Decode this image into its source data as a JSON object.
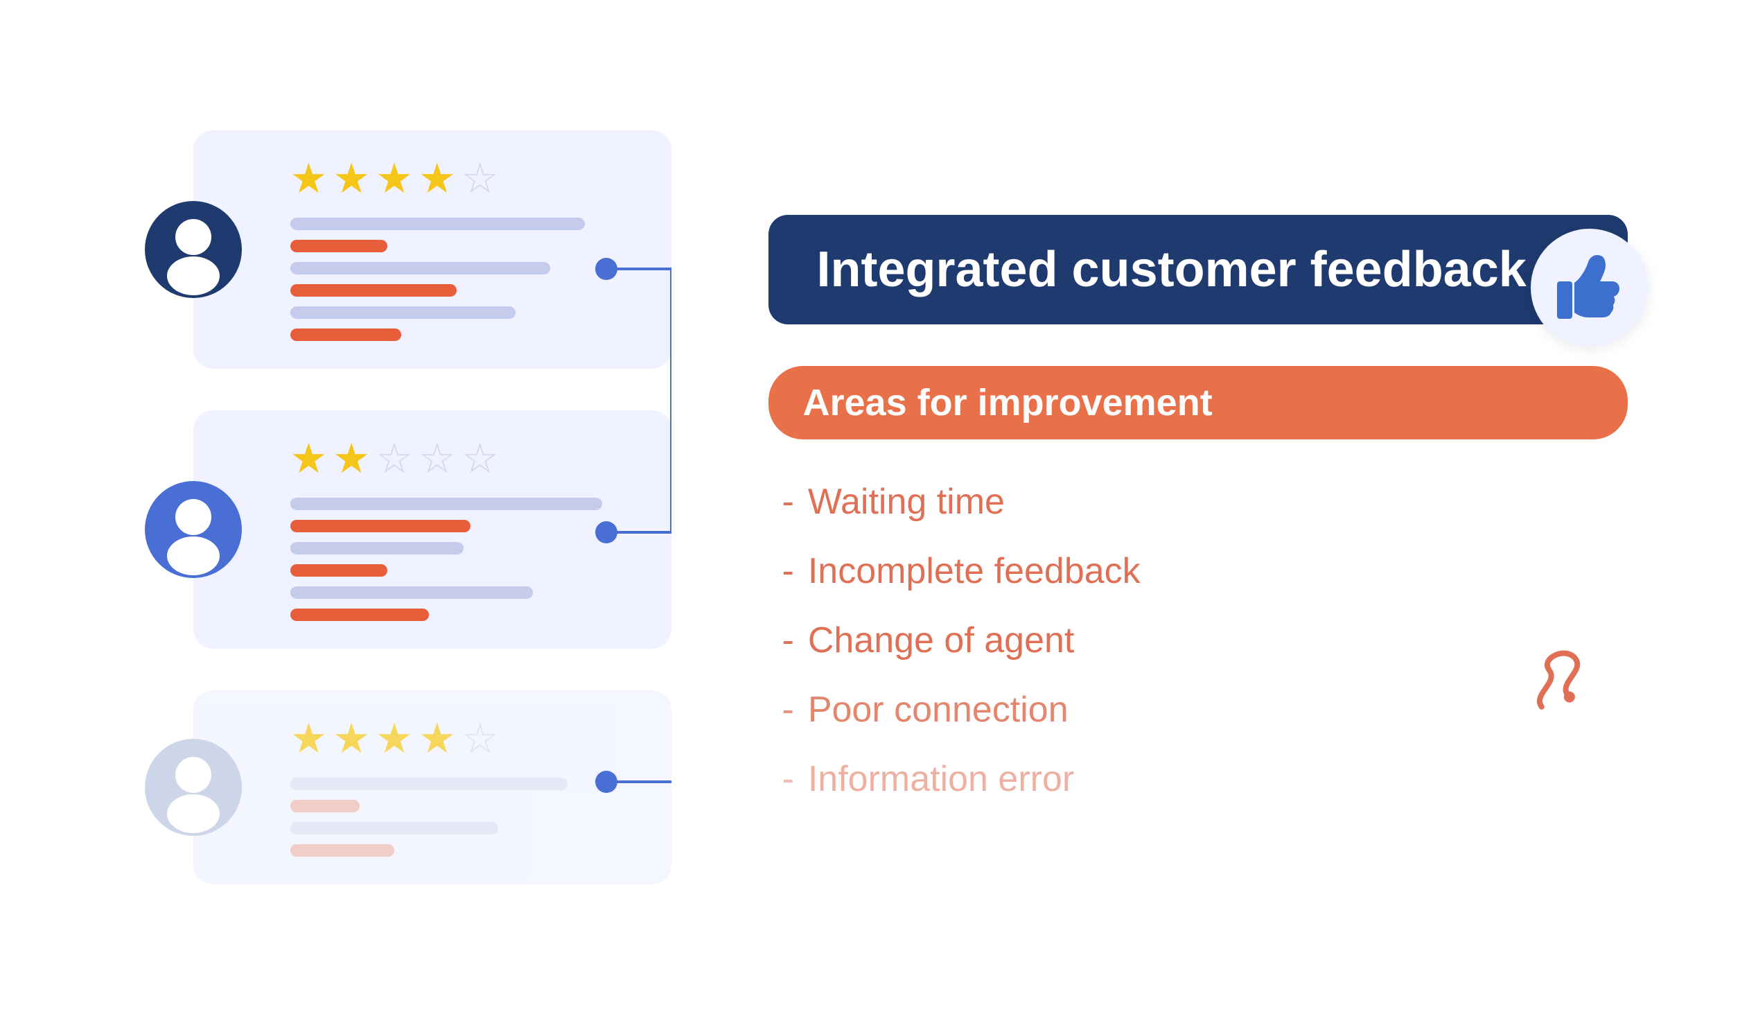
{
  "header": {
    "title": "Integrated customer feedback"
  },
  "areas_badge": {
    "label": "Areas for improvement"
  },
  "improvement_items": [
    {
      "id": "waiting-time",
      "label": "Waiting time",
      "strength": "strong"
    },
    {
      "id": "incomplete-feedback",
      "label": "Incomplete feedback",
      "strength": "strong"
    },
    {
      "id": "change-of-agent",
      "label": "Change of agent",
      "strength": "strong"
    },
    {
      "id": "poor-connection",
      "label": "Poor connection",
      "strength": "medium"
    },
    {
      "id": "information-error",
      "label": "Information error",
      "strength": "light"
    }
  ],
  "feedback_cards": [
    {
      "id": "card-1",
      "avatar_color": "#1e3a6e",
      "stars_filled": 4,
      "stars_empty": 1,
      "bars": [
        {
          "type": "bg",
          "width": "85%"
        },
        {
          "type": "accent",
          "width": "28%"
        },
        {
          "type": "bg",
          "width": "75%"
        },
        {
          "type": "accent",
          "width": "48%"
        },
        {
          "type": "bg",
          "width": "65%"
        },
        {
          "type": "accent",
          "width": "32%"
        }
      ]
    },
    {
      "id": "card-2",
      "avatar_color": "#4a6fd4",
      "stars_filled": 2,
      "stars_empty": 3,
      "bars": [
        {
          "type": "bg",
          "width": "90%"
        },
        {
          "type": "accent",
          "width": "52%"
        },
        {
          "type": "bg",
          "width": "50%"
        },
        {
          "type": "accent",
          "width": "28%"
        },
        {
          "type": "bg",
          "width": "70%"
        },
        {
          "type": "accent",
          "width": "40%"
        }
      ]
    },
    {
      "id": "card-3",
      "avatar_color": "#b8c4e0",
      "stars_filled": 4,
      "stars_empty": 1,
      "bars": [
        {
          "type": "bg",
          "width": "80%"
        },
        {
          "type": "accent-light",
          "width": "20%"
        },
        {
          "type": "bg",
          "width": "60%"
        },
        {
          "type": "accent-light",
          "width": "30%"
        }
      ]
    }
  ],
  "dash_label": "-",
  "squiggle_char": "∂"
}
